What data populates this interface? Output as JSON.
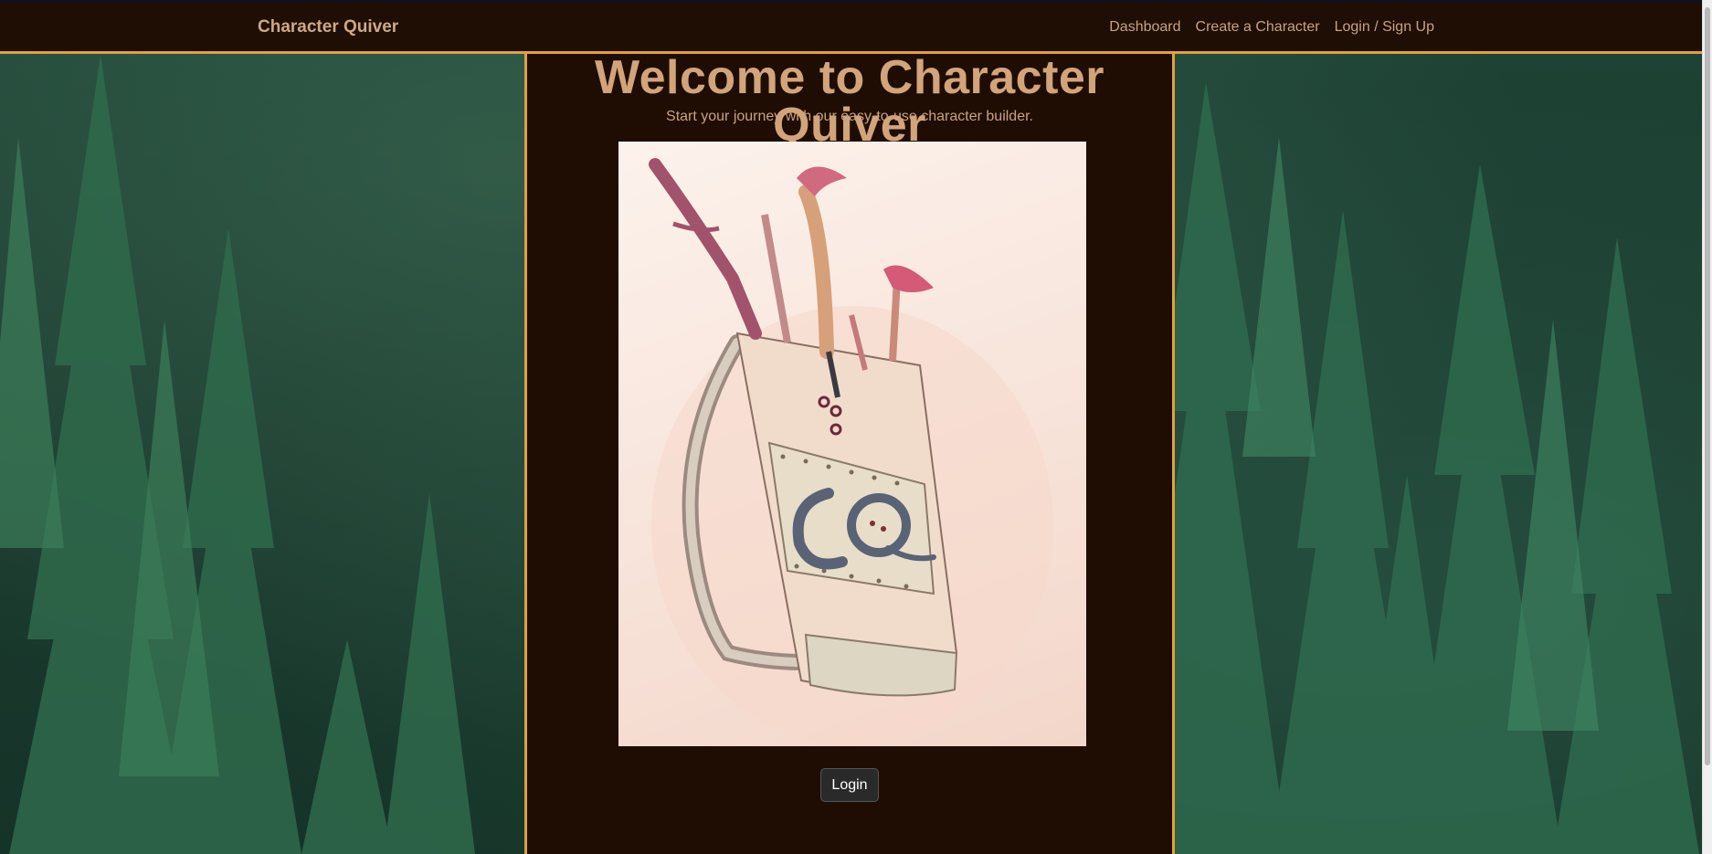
{
  "navbar": {
    "brand": "Character Quiver",
    "links": [
      {
        "label": "Dashboard"
      },
      {
        "label": "Create a Character"
      },
      {
        "label": "Login / Sign Up"
      }
    ]
  },
  "hero": {
    "title": "Welcome to Character Quiver",
    "subtitle": "Start your journey with our easy-to-use character builder.",
    "image_icon": "quiver-logo-illustration",
    "login_label": "Login"
  },
  "colors": {
    "accent": "#e0a23a",
    "nav_background": "#1e0e04",
    "panel_background": "#1f0d03",
    "text_tan": "#d1a47a",
    "button_background": "#2a2a2a"
  }
}
